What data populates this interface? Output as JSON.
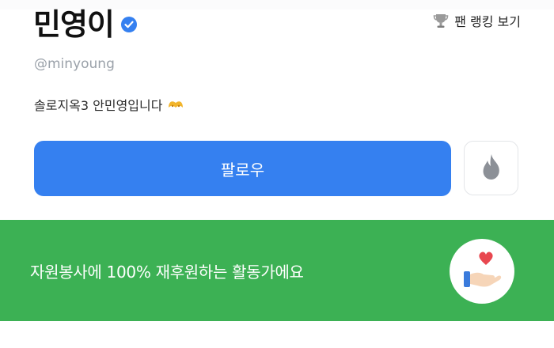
{
  "profile": {
    "display_name": "민영이",
    "username": "@minyoung",
    "bio": "솔로지옥3 안민영입니다"
  },
  "header": {
    "fan_ranking_label": "팬 랭킹 보기"
  },
  "actions": {
    "follow_label": "팔로우"
  },
  "banner": {
    "text": "자원봉사에 100% 재후원하는 활동가에요"
  },
  "icons": {
    "verified": "verified-badge-icon",
    "trophy": "trophy-icon",
    "bio_emoji": "hugging-hands-icon",
    "fire": "fire-icon",
    "donation": "heart-hand-icon"
  },
  "colors": {
    "follow": "#3580f0",
    "banner": "#3cb154",
    "verified": "#3580f0",
    "heart": "#e8474f"
  }
}
